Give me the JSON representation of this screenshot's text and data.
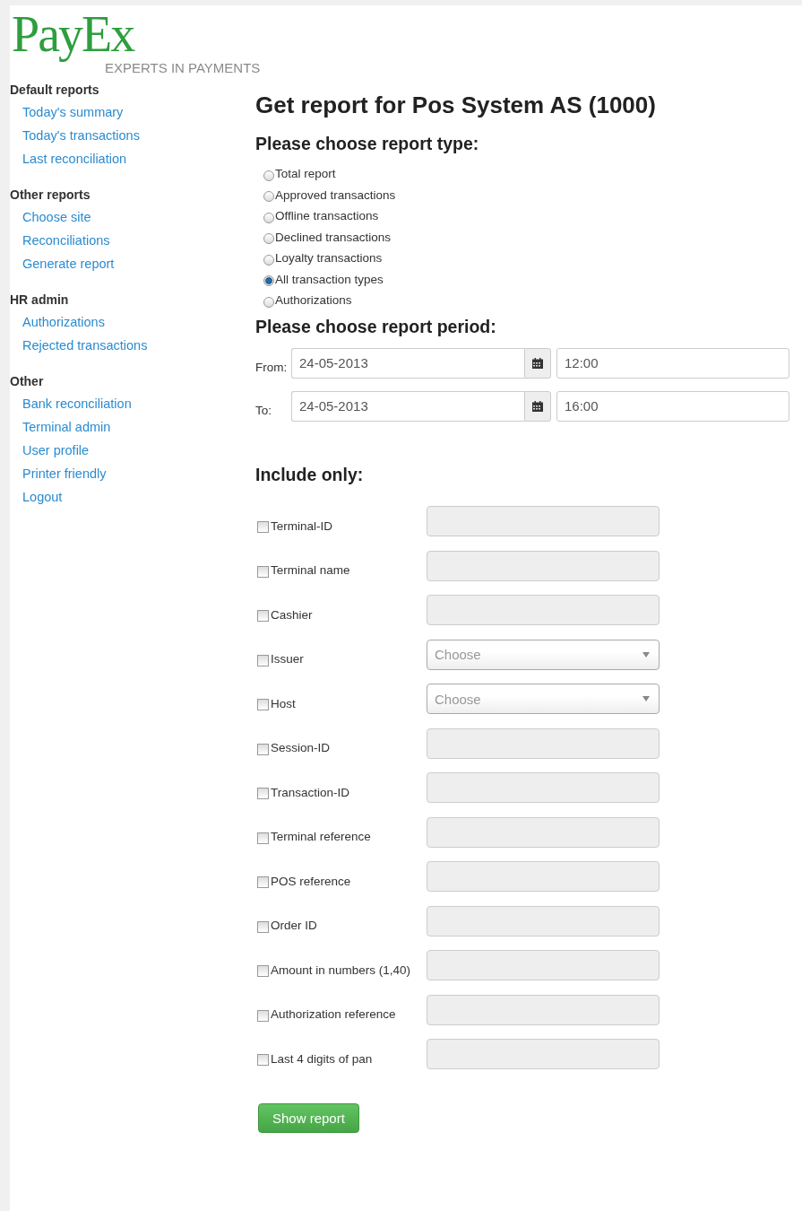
{
  "logo": {
    "name": "PayEx",
    "tagline": "EXPERTS IN PAYMENTS"
  },
  "sidebar": {
    "sections": [
      {
        "heading": "Default reports",
        "items": [
          "Today's summary",
          "Today's transactions",
          "Last reconciliation"
        ]
      },
      {
        "heading": "Other reports",
        "items": [
          "Choose site",
          "Reconciliations",
          "Generate report"
        ]
      },
      {
        "heading": "HR admin",
        "items": [
          "Authorizations",
          "Rejected transactions"
        ]
      },
      {
        "heading": "Other",
        "items": [
          "Bank reconciliation",
          "Terminal admin",
          "User profile",
          "Printer friendly",
          "Logout"
        ]
      }
    ]
  },
  "title": "Get report for Pos System AS (1000)",
  "report_type": {
    "heading": "Please choose report type:",
    "options": [
      {
        "label": "Total report",
        "selected": false
      },
      {
        "label": "Approved transactions",
        "selected": false
      },
      {
        "label": "Offline transactions",
        "selected": false
      },
      {
        "label": "Declined transactions",
        "selected": false
      },
      {
        "label": "Loyalty transactions",
        "selected": false
      },
      {
        "label": "All transaction types",
        "selected": true
      },
      {
        "label": "Authorizations",
        "selected": false
      }
    ]
  },
  "report_period": {
    "heading": "Please choose report period:",
    "rows": [
      {
        "label": "From:",
        "date": "24-05-2013",
        "time": "12:00"
      },
      {
        "label": "To:",
        "date": "24-05-2013",
        "time": "16:00"
      }
    ]
  },
  "include_only": {
    "heading": "Include only:",
    "filters": [
      {
        "label": "Terminal-ID",
        "kind": "text",
        "checked": false
      },
      {
        "label": "Terminal name",
        "kind": "text",
        "checked": false
      },
      {
        "label": "Cashier",
        "kind": "text",
        "checked": false
      },
      {
        "label": "Issuer",
        "kind": "select",
        "checked": false,
        "placeholder": "Choose"
      },
      {
        "label": "Host",
        "kind": "select",
        "checked": false,
        "placeholder": "Choose"
      },
      {
        "label": "Session-ID",
        "kind": "text",
        "checked": false
      },
      {
        "label": "Transaction-ID",
        "kind": "text",
        "checked": false
      },
      {
        "label": "Terminal reference",
        "kind": "text",
        "checked": false
      },
      {
        "label": "POS reference",
        "kind": "text",
        "checked": false
      },
      {
        "label": "Order ID",
        "kind": "text",
        "checked": false
      },
      {
        "label": "Amount in numbers (1,40)",
        "kind": "text",
        "checked": false
      },
      {
        "label": "Authorization reference",
        "kind": "text",
        "checked": false
      },
      {
        "label": "Last 4 digits of pan",
        "kind": "text",
        "checked": false
      }
    ]
  },
  "submit_button": "Show report"
}
